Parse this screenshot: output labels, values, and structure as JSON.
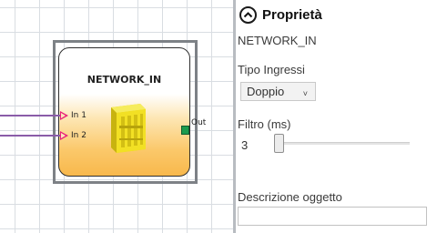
{
  "canvas": {
    "block": {
      "title": "NETWORK_IN",
      "inputs": [
        "In 1",
        "In 2"
      ],
      "output": "Out"
    }
  },
  "properties": {
    "title": "Proprietà",
    "object_name": "NETWORK_IN",
    "input_type": {
      "label": "Tipo Ingressi",
      "selected": "Doppio"
    },
    "filter": {
      "label": "Filtro (ms)",
      "value": "3"
    },
    "description": {
      "label": "Descrizione oggetto",
      "value": ""
    }
  },
  "colors": {
    "input_arrow": "#e8207a",
    "output_port": "#1c9b4e",
    "block_gradient_bottom": "#f8b84c",
    "device_yellow": "#f2e024"
  }
}
